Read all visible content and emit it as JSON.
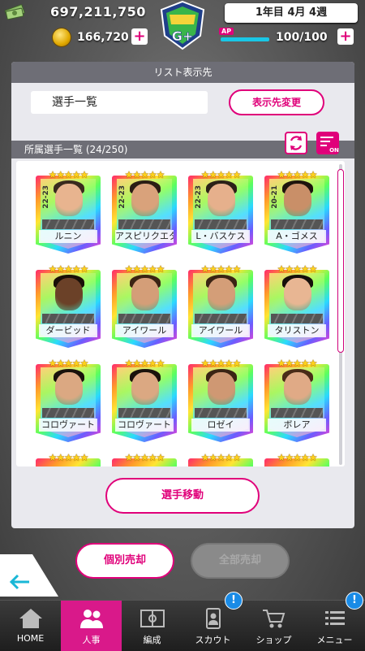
{
  "header": {
    "money": "697,211,750",
    "coins": "166,720",
    "date": "1年目 4月 4週",
    "ap_label": "AP",
    "ap_value": "100/100",
    "ap_fraction": 1.0,
    "plus": "+",
    "grade": "G+"
  },
  "list_dest": {
    "heading": "リスト表示先",
    "current": "選手一覧",
    "change_button": "表示先変更"
  },
  "roster": {
    "heading": "所属選手一覧 (24/250)",
    "filter_label": "ON",
    "stars": "★★★★★",
    "cards": [
      {
        "name": "ルニン",
        "season": "22-23",
        "skin": "#e8b48f",
        "hair": "#3a2a1e"
      },
      {
        "name": "アスピリクエタ",
        "season": "22-23",
        "skin": "#d9a27b",
        "hair": "#2a1d14"
      },
      {
        "name": "L・バスケス",
        "season": "22-23",
        "skin": "#e6b08c",
        "hair": "#2c2118"
      },
      {
        "name": "A・ゴメス",
        "season": "20-21",
        "skin": "#c98f68",
        "hair": "#1e140d"
      },
      {
        "name": "ダービッド",
        "season": "",
        "skin": "#6b4128",
        "hair": "#1a1008"
      },
      {
        "name": "アイワール",
        "season": "",
        "skin": "#d49e78",
        "hair": "#3b2414"
      },
      {
        "name": "アイワール",
        "season": "",
        "skin": "#d49e78",
        "hair": "#3b2414"
      },
      {
        "name": "タリストン",
        "season": "",
        "skin": "#e8b693",
        "hair": "#16100b"
      },
      {
        "name": "コロヴァート",
        "season": "",
        "skin": "#dba882",
        "hair": "#1a120c"
      },
      {
        "name": "コロヴァート",
        "season": "",
        "skin": "#dba882",
        "hair": "#1a120c"
      },
      {
        "name": "ロゼイ",
        "season": "",
        "skin": "#cf9873",
        "hair": "#3a2414"
      },
      {
        "name": "ボレア",
        "season": "",
        "skin": "#e0aa86",
        "hair": "#4a2c18"
      }
    ],
    "move_button": "選手移動"
  },
  "actions": {
    "sell_one": "個別売却",
    "sell_all": "全部売却"
  },
  "nav": {
    "items": [
      {
        "label": "HOME",
        "icon": "home-icon"
      },
      {
        "label": "人事",
        "icon": "people-icon"
      },
      {
        "label": "編成",
        "icon": "pitch-icon"
      },
      {
        "label": "スカウト",
        "icon": "scout-icon"
      },
      {
        "label": "ショップ",
        "icon": "cart-icon"
      },
      {
        "label": "メニュー",
        "icon": "menu-icon"
      }
    ],
    "notif_mark": "!"
  },
  "colors": {
    "accent": "#e0007a",
    "ap_bar": "#19c7e6",
    "notif": "#1a8be6"
  }
}
